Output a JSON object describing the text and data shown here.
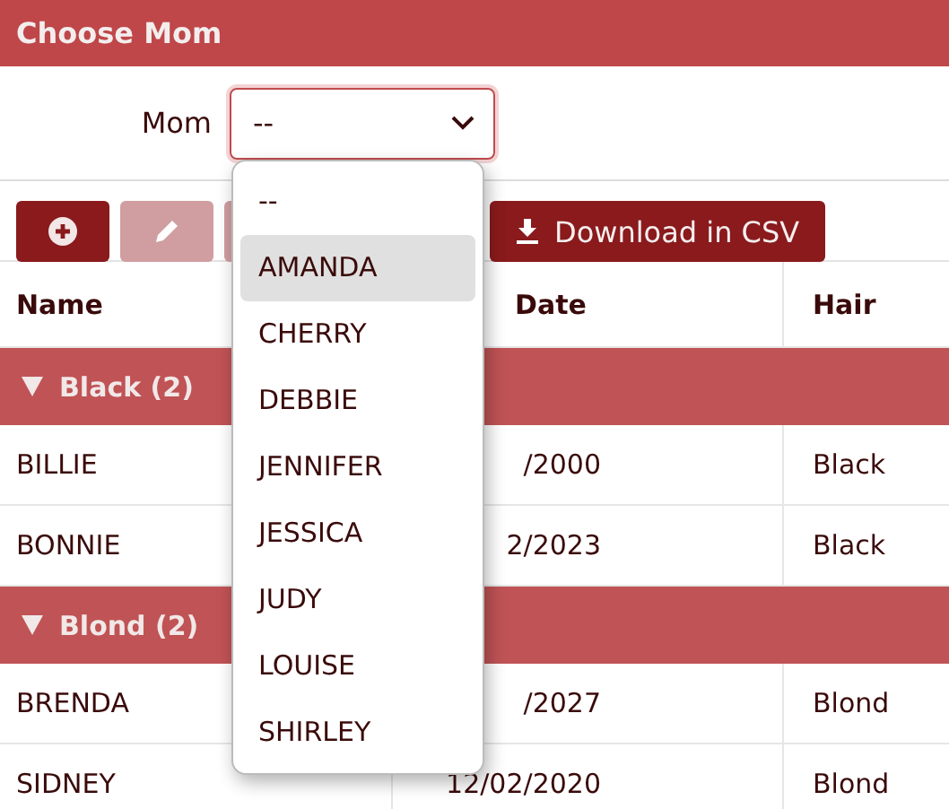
{
  "panel": {
    "title": "Choose Mom"
  },
  "form": {
    "label": "Mom",
    "select": {
      "value": "--",
      "open": true,
      "options": [
        {
          "label": "--",
          "highlighted": false
        },
        {
          "label": "AMANDA",
          "highlighted": true
        },
        {
          "label": "CHERRY",
          "highlighted": false
        },
        {
          "label": "DEBBIE",
          "highlighted": false
        },
        {
          "label": "JENNIFER",
          "highlighted": false
        },
        {
          "label": "JESSICA",
          "highlighted": false
        },
        {
          "label": "JUDY",
          "highlighted": false
        },
        {
          "label": "LOUISE",
          "highlighted": false
        },
        {
          "label": "SHIRLEY",
          "highlighted": false
        }
      ]
    }
  },
  "toolbar": {
    "buttons": [
      {
        "kind": "add",
        "disabled": false
      },
      {
        "kind": "edit",
        "disabled": true
      },
      {
        "kind": "blank",
        "disabled": true
      },
      {
        "kind": "download",
        "label": "Download in CSV",
        "disabled": false
      }
    ]
  },
  "table": {
    "columns": [
      "Name",
      "Date",
      "Hair"
    ],
    "groups": [
      {
        "label": "Black (2)",
        "expanded": true,
        "rows": [
          [
            "BILLIE",
            "/2000",
            "Black"
          ],
          [
            "BONNIE",
            "2/2023",
            "Black"
          ]
        ]
      },
      {
        "label": "Blond (2)",
        "expanded": true,
        "rows": [
          [
            "BRENDA",
            "/2027",
            "Blond"
          ],
          [
            "SIDNEY",
            "12/02/2020",
            "Blond"
          ]
        ]
      }
    ]
  }
}
